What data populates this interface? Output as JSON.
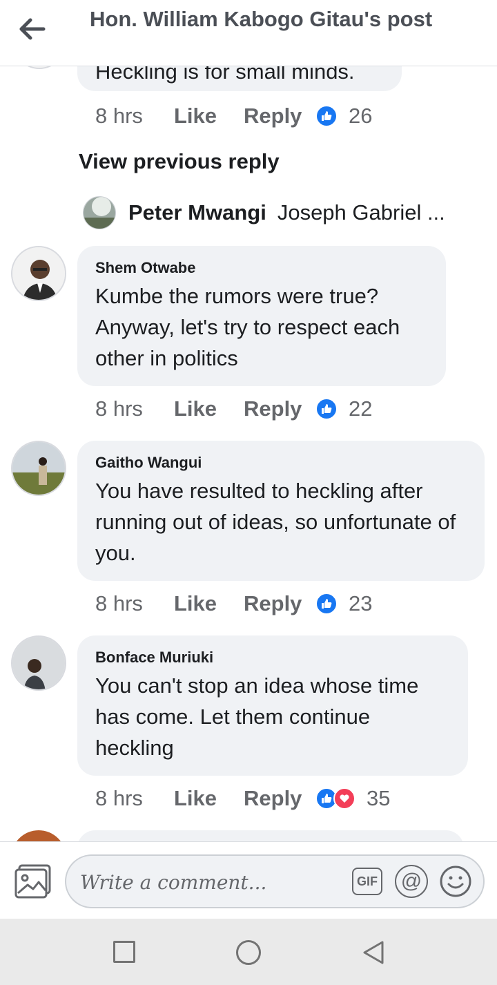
{
  "header": {
    "title": "Hon. William Kabogo Gitau's post",
    "back_icon": "arrow-left-icon"
  },
  "previous_comment": {
    "text": "Heckling is for small minds.",
    "time": "8 hrs",
    "like_label": "Like",
    "reply_label": "Reply",
    "reaction_count": "26"
  },
  "view_previous_reply": "View previous reply",
  "reply_preview": {
    "author": "Peter Mwangi",
    "text": "Joseph Gabriel ..."
  },
  "comments": [
    {
      "author": "Shem Otwabe",
      "text": "Kumbe the rumors were true? Anyway, let's try to respect each other in politics",
      "time": "8 hrs",
      "like_label": "Like",
      "reply_label": "Reply",
      "reaction_count": "22"
    },
    {
      "author": "Gaitho Wangui",
      "text": "You have resulted to heckling after running out of ideas, so unfortunate of you.",
      "time": "8 hrs",
      "like_label": "Like",
      "reply_label": "Reply",
      "reaction_count": "23"
    },
    {
      "author": "Bonface Muriuki",
      "text": "You can't stop an idea whose time has come. Let them continue heckling",
      "time": "8 hrs",
      "like_label": "Like",
      "reply_label": "Reply",
      "reaction_count": "35"
    }
  ],
  "composer": {
    "placeholder": "Write a comment...",
    "gif_label": "GIF",
    "at_label": "@"
  },
  "colors": {
    "accent": "#1877f2",
    "heart": "#f33e58",
    "bubble": "#f0f2f5",
    "muted": "#65676b"
  }
}
